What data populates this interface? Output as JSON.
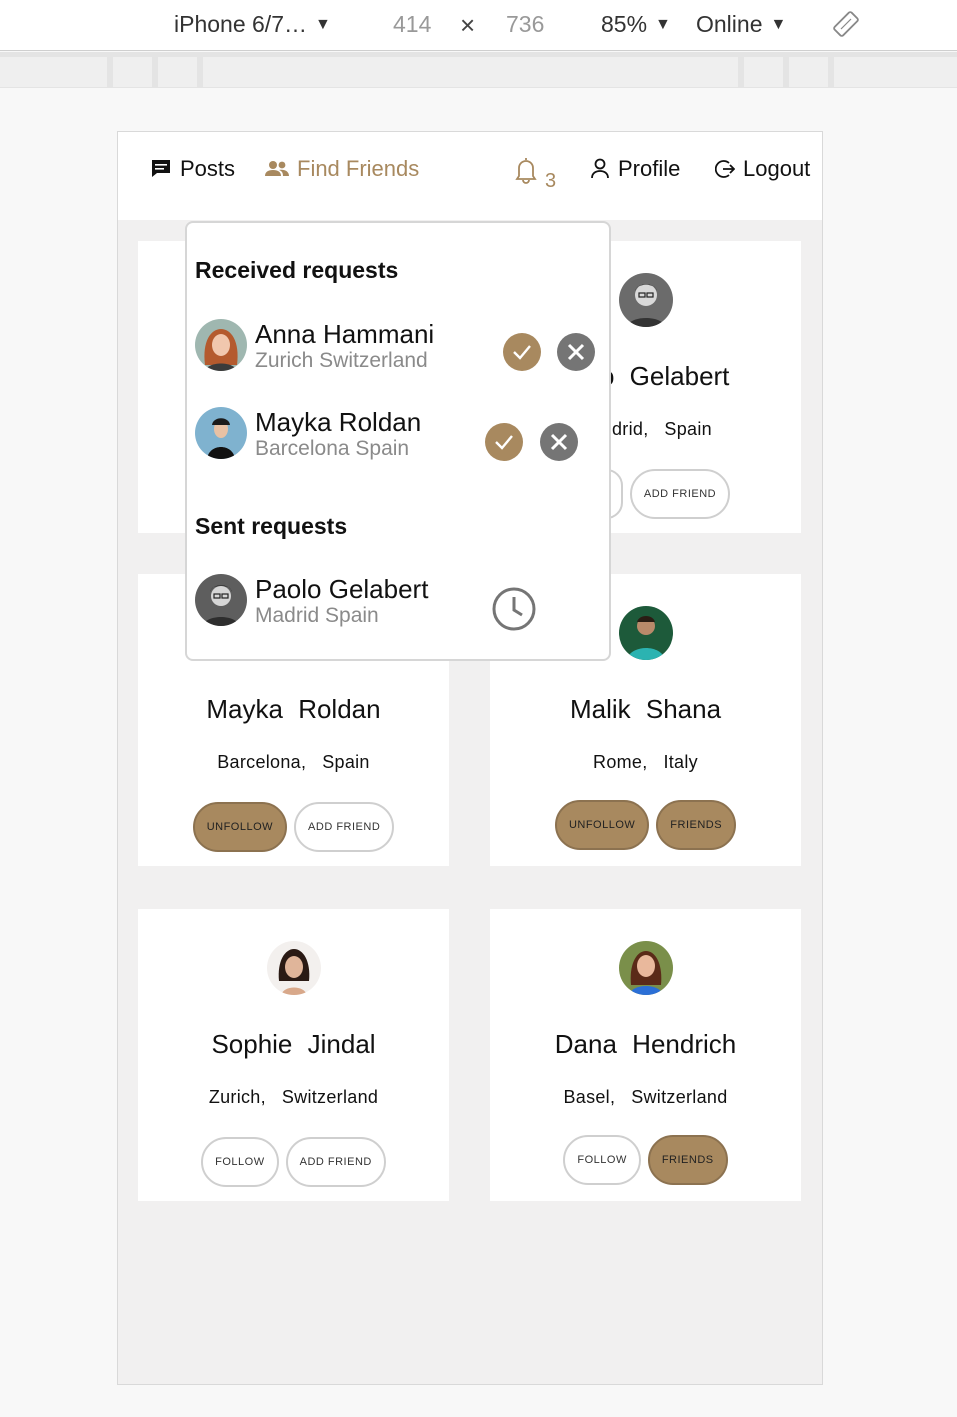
{
  "devtools": {
    "device": "iPhone 6/7…",
    "width": "414",
    "times": "×",
    "height": "736",
    "zoom": "85%",
    "network": "Online"
  },
  "nav": {
    "posts": "Posts",
    "find_friends": "Find Friends",
    "notification_count": "3",
    "profile": "Profile",
    "logout": "Logout"
  },
  "dropdown": {
    "received_title": "Received requests",
    "received": [
      {
        "name": "Anna Hammani",
        "location": "Zurich Switzerland"
      },
      {
        "name": "Mayka Roldan",
        "location": "Barcelona Spain"
      }
    ],
    "sent_title": "Sent requests",
    "sent": [
      {
        "name": "Paolo Gelabert",
        "location": "Madrid Spain"
      }
    ]
  },
  "cards": [
    {
      "name": "o  Gelabert",
      "city": "drid,",
      "country": "Spain",
      "btn1": "W",
      "btn2": "ADD FRIEND"
    },
    {
      "name": "Mayka  Roldan",
      "city": "Barcelona,",
      "country": "Spain",
      "btn1": "UNFOLLOW",
      "btn2": "ADD FRIEND"
    },
    {
      "name": "Malik  Shana",
      "city": "Rome,",
      "country": "Italy",
      "btn1": "UNFOLLOW",
      "btn2": "FRIENDS"
    },
    {
      "name": "Sophie  Jindal",
      "city": "Zurich,",
      "country": "Switzerland",
      "btn1": "FOLLOW",
      "btn2": "ADD FRIEND"
    },
    {
      "name": "Dana  Hendrich",
      "city": "Basel,",
      "country": "Switzerland",
      "btn1": "FOLLOW",
      "btn2": "FRIENDS"
    }
  ],
  "colors": {
    "accent": "#a8895f",
    "reject": "#757575",
    "background": "#f1f0f0"
  }
}
